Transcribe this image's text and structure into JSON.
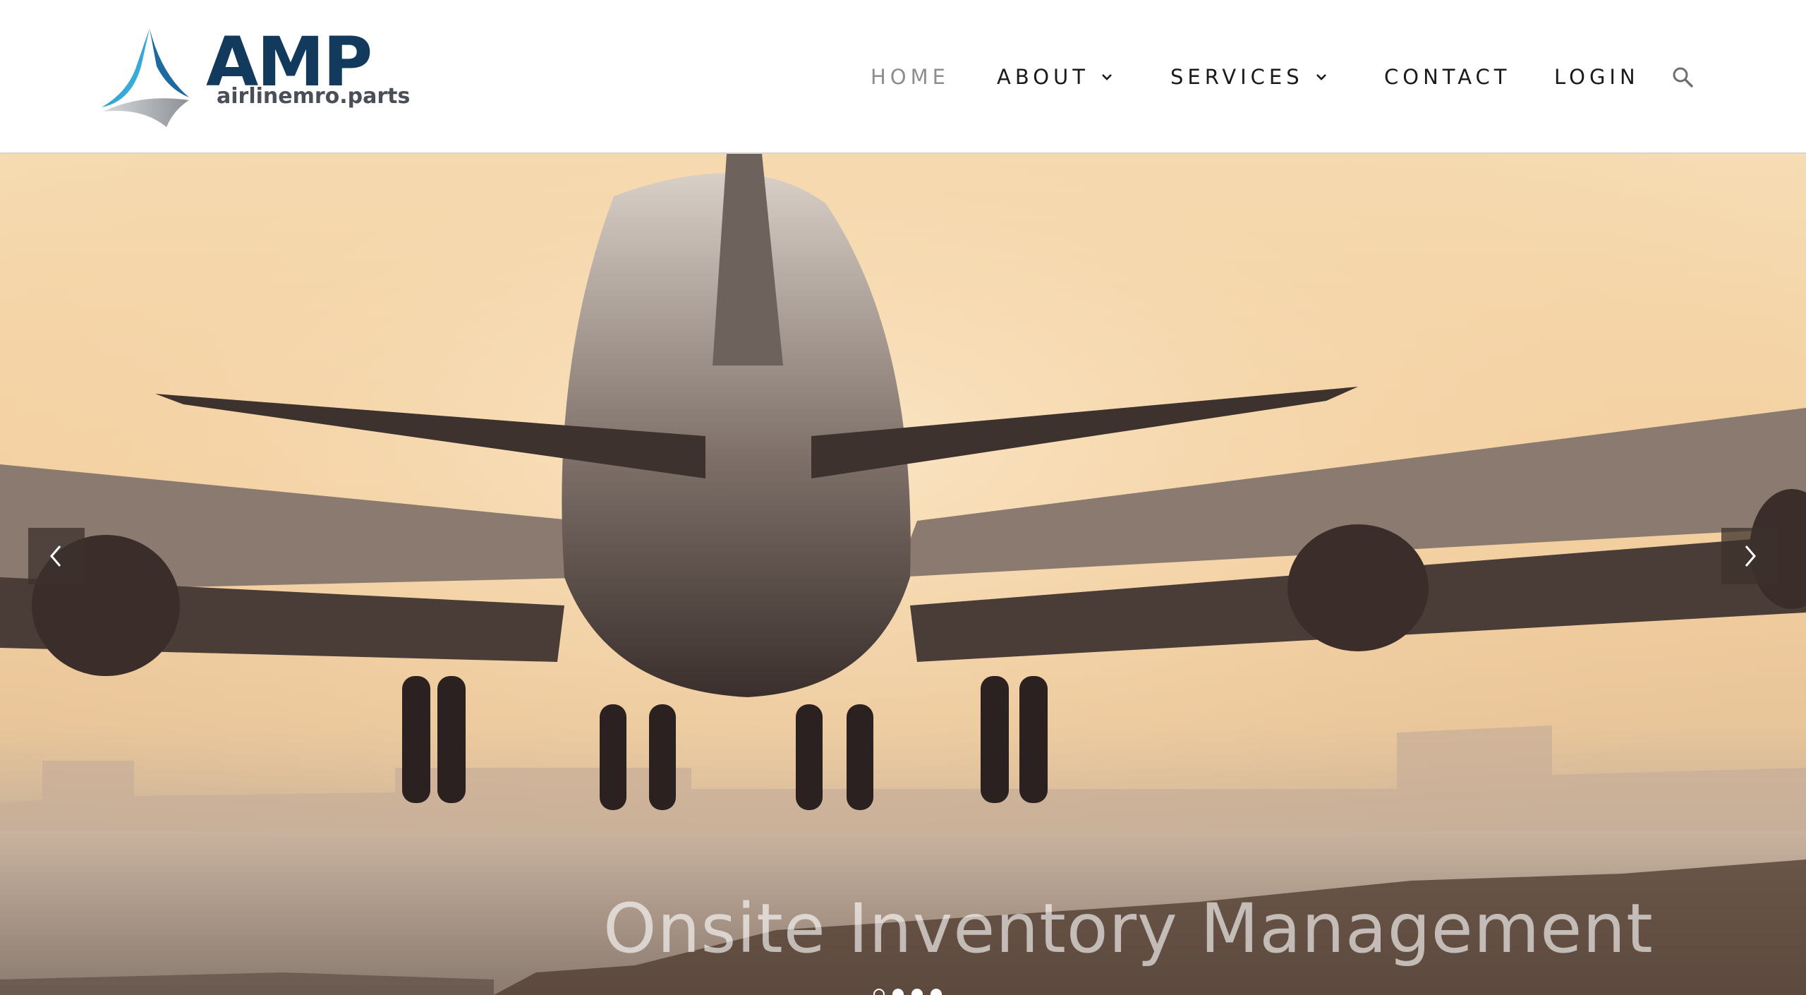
{
  "brand": {
    "title": "AMP",
    "subtitle": "airlinemro.parts",
    "primary_color": "#123a5c",
    "accent_color": "#2a9fd6"
  },
  "nav": {
    "home": "HOME",
    "about": "ABOUT",
    "services": "SERVICES",
    "contact": "CONTACT",
    "login": "LOGIN",
    "search_icon": "search-icon",
    "dropdown_icon": "chevron-down-icon"
  },
  "hero": {
    "caption": "Onsite Inventory Management",
    "prev_icon": "chevron-left-icon",
    "next_icon": "chevron-right-icon",
    "slide_count": 4,
    "active_slide": 1
  }
}
